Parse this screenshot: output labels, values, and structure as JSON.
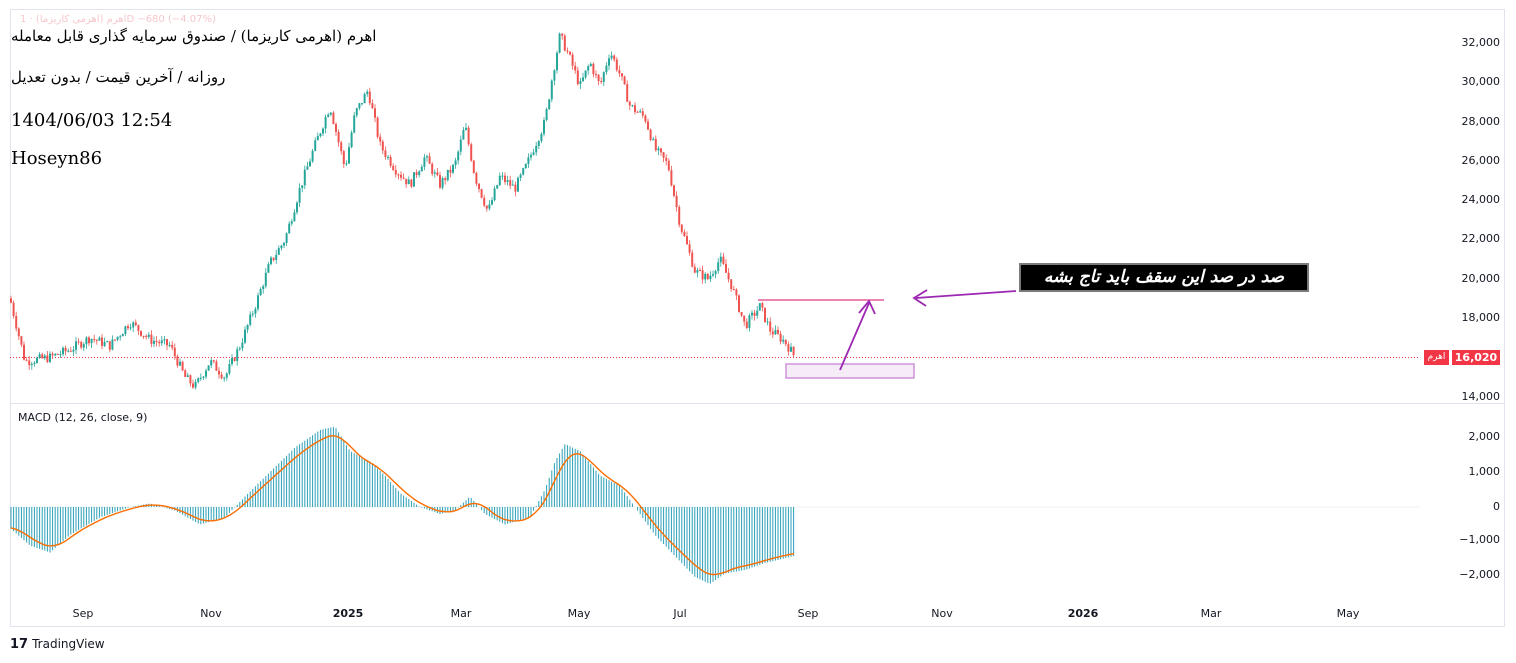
{
  "header": {
    "faint_legend": "اهرم (اهرمی کاریزما) · 1D  −680 (−4.07%)",
    "title": "اهرم (اهرمی کاریزما) / صندوق سرمایه گذاری قابل معامله",
    "interval": "روزانه / آخرین قیمت / بدون تعدیل",
    "datetime": "1404/06/03 12:54",
    "author": "Hoseyn86"
  },
  "price_axis": {
    "labels": [
      "32,000",
      "30,000",
      "28,000",
      "26,000",
      "24,000",
      "22,000",
      "20,000",
      "18,000",
      "16,000",
      "14,000"
    ]
  },
  "last_price": {
    "symbol": "اهرم",
    "value": "16,020"
  },
  "macd": {
    "label": "MACD (12, 26, close, 9)",
    "axis_labels": [
      "2,000",
      "1,000",
      "0",
      "−1,000",
      "−2,000"
    ]
  },
  "time_axis": {
    "labels": [
      "Sep",
      "Nov",
      "2025",
      "Mar",
      "May",
      "Jul",
      "Sep",
      "Nov",
      "2026",
      "Mar",
      "May"
    ]
  },
  "annotation": {
    "text": "صد در صد این سقف باید تاج بشه"
  },
  "branding": {
    "name": "TradingView"
  },
  "colors": {
    "up": "#26a69a",
    "down": "#ef5350",
    "macd_hist": "#2a9fb7",
    "signal": "#ff6d00",
    "annotation": "#9c27b0",
    "price_line": "#f23645"
  }
}
